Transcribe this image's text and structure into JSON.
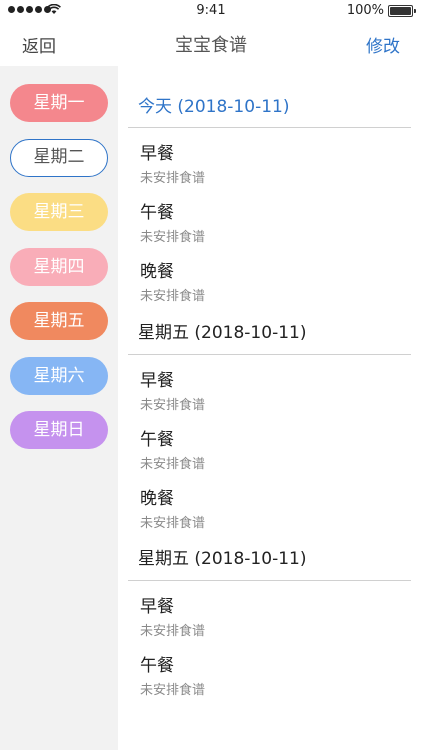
{
  "status_bar": {
    "time": "9:41",
    "battery_text": "100%",
    "signal_icon": "signal-dots-icon",
    "wifi_icon": "wifi-icon",
    "battery_icon": "battery-icon"
  },
  "nav": {
    "back_label": "返回",
    "title": "宝宝食谱",
    "edit_label": "修改"
  },
  "colors": {
    "accent": "#2f74c8"
  },
  "sidebar": {
    "days": [
      {
        "label": "星期一",
        "color": "#f4878d",
        "selected": false
      },
      {
        "label": "星期二",
        "color": "#ffffff",
        "selected": true
      },
      {
        "label": "星期三",
        "color": "#fbdd84",
        "selected": false
      },
      {
        "label": "星期四",
        "color": "#f9adb8",
        "selected": false
      },
      {
        "label": "星期五",
        "color": "#f0895f",
        "selected": false
      },
      {
        "label": "星期六",
        "color": "#86b6f4",
        "selected": false
      },
      {
        "label": "星期日",
        "color": "#c592ee",
        "selected": false
      }
    ]
  },
  "main": {
    "sections": [
      {
        "title": "今天 (2018-10-11)",
        "meals": [
          {
            "name": "早餐",
            "status": "未安排食谱"
          },
          {
            "name": "午餐",
            "status": "未安排食谱"
          },
          {
            "name": "晚餐",
            "status": "未安排食谱"
          }
        ]
      },
      {
        "title": "星期五 (2018-10-11)",
        "meals": [
          {
            "name": "早餐",
            "status": "未安排食谱"
          },
          {
            "name": "午餐",
            "status": "未安排食谱"
          },
          {
            "name": "晚餐",
            "status": "未安排食谱"
          }
        ]
      },
      {
        "title": "星期五 (2018-10-11)",
        "meals": [
          {
            "name": "早餐",
            "status": "未安排食谱"
          },
          {
            "name": "午餐",
            "status": "未安排食谱"
          }
        ]
      }
    ]
  }
}
